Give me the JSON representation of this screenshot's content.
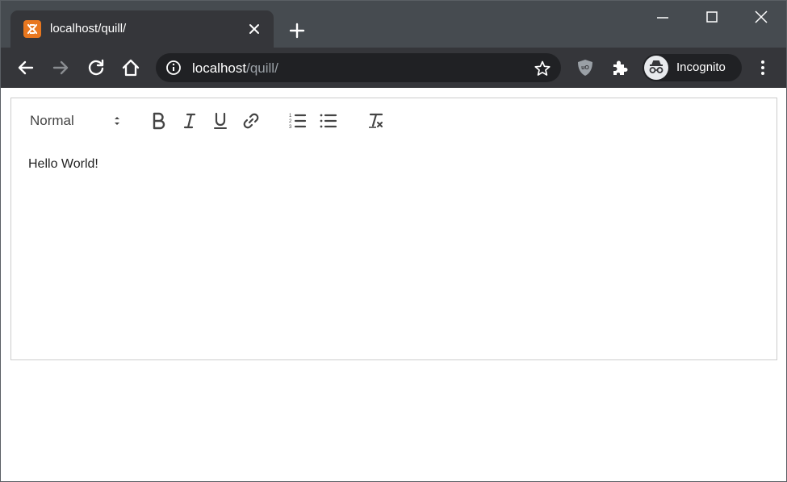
{
  "browser": {
    "tab": {
      "title": "localhost/quill/",
      "favicon": "xampp-icon"
    },
    "address": {
      "host": "localhost",
      "path": "/quill/"
    },
    "profile": {
      "label": "Incognito"
    },
    "colors": {
      "frame": "#464b50",
      "toolbar": "#35363a",
      "omnibox": "#202124",
      "favicon": "#e8771f"
    }
  },
  "editor": {
    "toolbar": {
      "header_picker": "Normal",
      "buttons": [
        "bold-icon",
        "italic-icon",
        "underline-icon",
        "link-icon",
        "ordered-list-icon",
        "bullet-list-icon",
        "clean-format-icon"
      ]
    },
    "content": "Hello World!"
  }
}
